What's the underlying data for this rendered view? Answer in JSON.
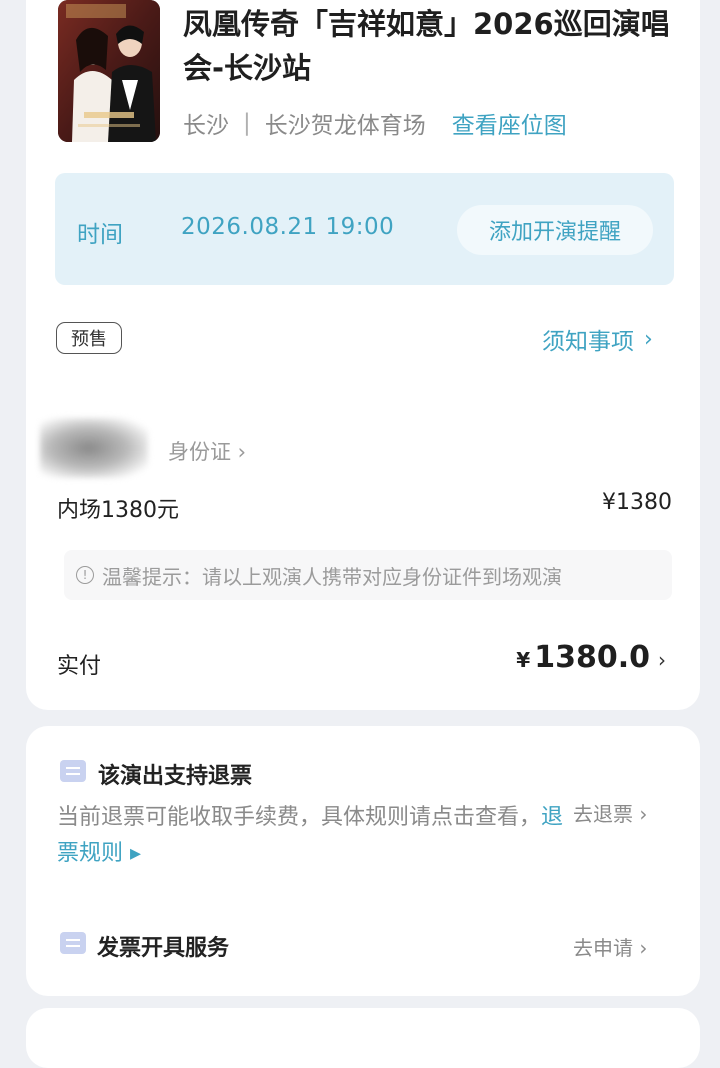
{
  "event": {
    "title": "凤凰传奇「吉祥如意」2026巡回演唱会-长沙站",
    "city": "长沙",
    "separator": "|",
    "venue": "长沙贺龙体育场",
    "seat_map_link": "查看座位图"
  },
  "time": {
    "label": "时间",
    "value": "2026.08.21 19:00",
    "remind_button": "添加开演提醒"
  },
  "presale_badge": "预售",
  "notice_link": "须知事项",
  "viewer": {
    "id_label": "身份证 ›"
  },
  "ticket": {
    "name": "内场1380元",
    "price": "¥1380"
  },
  "tip": "温馨提示：请以上观演人携带对应身份证件到场观演",
  "payment": {
    "label": "实付",
    "currency": "¥",
    "amount": "1380.0"
  },
  "refund": {
    "title": "该演出支持退票",
    "desc": "当前退票可能收取手续费，具体规则请点击查看，",
    "rule_link": "退票规则 ▸",
    "action": "去退票 ›"
  },
  "invoice": {
    "title": "发票开具服务",
    "action": "去申请 ›"
  },
  "colors": {
    "accent": "#3fa3c2",
    "time_box_bg": "#e3f1f8"
  }
}
